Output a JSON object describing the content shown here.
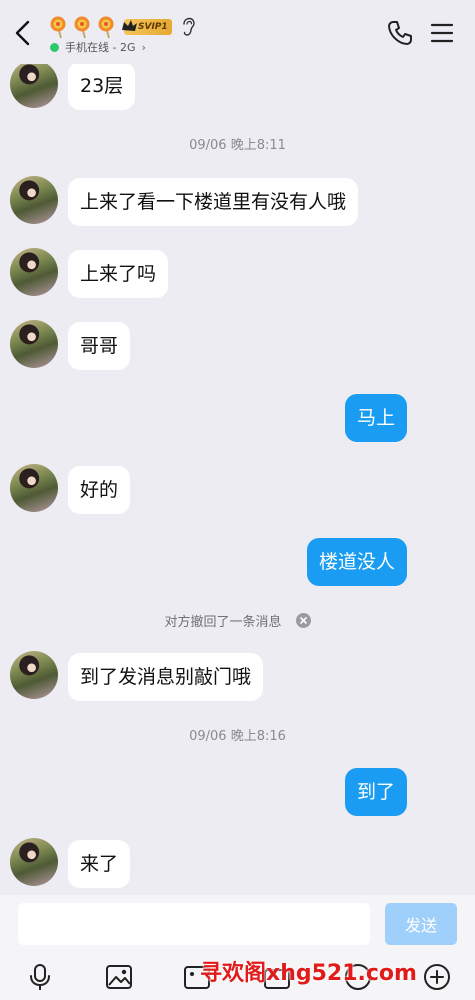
{
  "header": {
    "badge_text": "SVIP1",
    "status_text": "手机在线 - 2G",
    "status_arrow": "›"
  },
  "messages": [
    {
      "type": "in",
      "text": "23层"
    },
    {
      "type": "time",
      "text": "09/06 晚上8:11"
    },
    {
      "type": "in",
      "text": "上来了看一下楼道里有没有人哦"
    },
    {
      "type": "in",
      "text": "上来了吗"
    },
    {
      "type": "in",
      "text": "哥哥"
    },
    {
      "type": "out",
      "text": "马上"
    },
    {
      "type": "in",
      "text": "好的"
    },
    {
      "type": "out",
      "text": "楼道没人"
    },
    {
      "type": "recall",
      "text": "对方撤回了一条消息"
    },
    {
      "type": "in",
      "text": "到了发消息别敲门哦"
    },
    {
      "type": "time",
      "text": "09/06 晚上8:16"
    },
    {
      "type": "out",
      "text": "到了"
    },
    {
      "type": "in",
      "text": "来了"
    }
  ],
  "input": {
    "placeholder": "",
    "send_label": "发送"
  },
  "toolbar": {
    "icons": [
      "microphone-icon",
      "image-icon",
      "gif-icon",
      "camera-icon",
      "emoji-icon",
      "plus-icon"
    ]
  },
  "watermark": "寻欢阁xhg521.com",
  "colors": {
    "outgoing_bubble": "#1a9cf2",
    "incoming_bubble": "#ffffff",
    "background": "#ececf2",
    "send_button": "#9fd0fb",
    "online_dot": "#2ec86a"
  }
}
